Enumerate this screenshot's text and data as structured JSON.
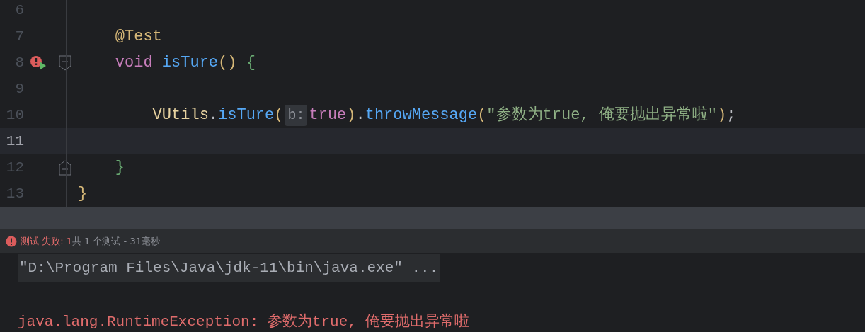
{
  "editor": {
    "lines": [
      {
        "number": "6",
        "current": false
      },
      {
        "number": "7",
        "current": false,
        "tokens": [
          {
            "kind": "annotation",
            "text": "    @Test"
          }
        ]
      },
      {
        "number": "8",
        "current": false,
        "test_failed": true,
        "fold_start": true,
        "tokens": [
          {
            "kind": "keyword",
            "text": "    void"
          },
          {
            "kind": "method",
            "text": " isTure"
          },
          {
            "kind": "paren",
            "text": "()"
          },
          {
            "kind": "brace",
            "text": " {"
          }
        ]
      },
      {
        "number": "9",
        "current": false
      },
      {
        "number": "10",
        "current": false,
        "tokens": [
          {
            "kind": "class",
            "text": "        VUtils"
          },
          {
            "kind": "plain",
            "text": "."
          },
          {
            "kind": "method",
            "text": "isTure"
          },
          {
            "kind": "paren",
            "text": "("
          },
          {
            "kind": "hint",
            "text": "b:"
          },
          {
            "kind": "keyword",
            "text": "true"
          },
          {
            "kind": "paren",
            "text": ")"
          },
          {
            "kind": "plain",
            "text": "."
          },
          {
            "kind": "method",
            "text": "throwMessage"
          },
          {
            "kind": "paren",
            "text": "("
          },
          {
            "kind": "string",
            "text": "\"参数为true, 俺要抛出异常啦\""
          },
          {
            "kind": "paren",
            "text": ")"
          },
          {
            "kind": "plain",
            "text": ";"
          }
        ]
      },
      {
        "number": "11",
        "current": true
      },
      {
        "number": "12",
        "current": false,
        "fold_end": true,
        "tokens": [
          {
            "kind": "brace",
            "text": "    }"
          }
        ]
      },
      {
        "number": "13",
        "current": false,
        "tokens": [
          {
            "kind": "paren",
            "text": "}"
          }
        ]
      }
    ]
  },
  "test_status": {
    "failed_label": "测试 失败: 1",
    "summary": "共 1 个测试 - 31毫秒"
  },
  "console": {
    "lines": [
      {
        "kind": "command",
        "text": "\"D:\\Program Files\\Java\\jdk-11\\bin\\java.exe\" ..."
      },
      {
        "kind": "error",
        "text": "java.lang.RuntimeException: 参数为true, 俺要抛出异常啦"
      }
    ]
  }
}
